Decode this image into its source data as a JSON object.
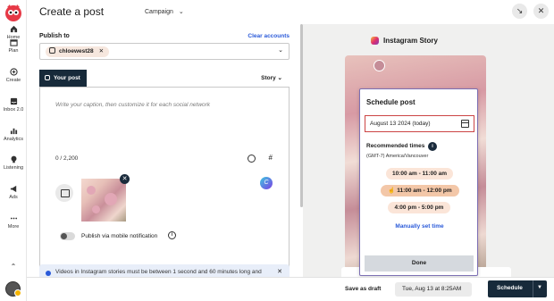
{
  "rail": {
    "items": [
      {
        "label": "Home",
        "icon": "home-icon"
      },
      {
        "label": "Plan",
        "icon": "calendar-icon"
      },
      {
        "label": "Create",
        "icon": "plus-circle-icon"
      },
      {
        "label": "Inbox 2.0",
        "icon": "inbox-icon"
      },
      {
        "label": "Analytics",
        "icon": "bar-chart-icon"
      },
      {
        "label": "Listening",
        "icon": "lightbulb-icon"
      },
      {
        "label": "Ads",
        "icon": "megaphone-icon"
      },
      {
        "label": "More",
        "icon": "more-dots-icon"
      }
    ]
  },
  "header": {
    "title": "Create a post",
    "campaign": "Campaign"
  },
  "composer": {
    "publish_to_label": "Publish to",
    "clear_accounts": "Clear accounts",
    "account_chip": "chloewest28",
    "tab_label": "Your post",
    "story_label": "Story",
    "caption_placeholder": "Write your caption, then customize it for each social network",
    "char_count": "0 / 2,200",
    "hash_symbol": "#",
    "mobile_notification": "Publish via mobile notification",
    "notice": "Videos in Instagram stories must be between 1 second and 60 minutes long and"
  },
  "preview": {
    "title": "Instagram Story"
  },
  "schedule": {
    "title": "Schedule post",
    "date_value": "August 13 2024 (today)",
    "recommended_label": "Recommended times",
    "timezone": "(GMT-7) America/Vancouver",
    "slots": [
      {
        "label": "10:00 am - 11:00 am",
        "selected": false
      },
      {
        "label": "11:00 am - 12:00 pm",
        "selected": true
      },
      {
        "label": "4:00 pm - 5:00 pm",
        "selected": false
      }
    ],
    "manual_link": "Manually set time",
    "done_label": "Done"
  },
  "footer": {
    "save_draft": "Save as draft",
    "scheduled_time": "Tue, Aug 13 at 8:25AM",
    "schedule_button": "Schedule"
  },
  "colors": {
    "brand_navy": "#172a3a",
    "link_blue": "#2a5ad9",
    "slot_peach": "#fbe5d8",
    "slot_selected": "#f3c7a8",
    "highlight_red": "#cc4444"
  }
}
